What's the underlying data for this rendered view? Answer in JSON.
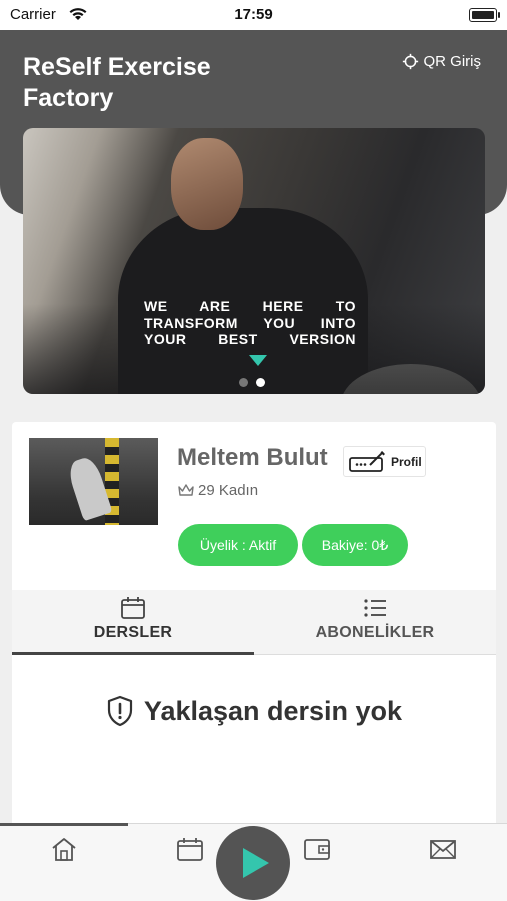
{
  "status_bar": {
    "carrier": "Carrier",
    "time": "17:59"
  },
  "header": {
    "title": "ReSelf Exercise Factory",
    "qr_label": "QR Giriş"
  },
  "banner": {
    "text": "WE ARE HERE TO TRANSFORM YOU INTO YOUR BEST VERSION",
    "slides": 2,
    "active_slide": 2
  },
  "profile": {
    "name": "Meltem Bulut",
    "edit_label": "Profil",
    "meta": "29 Kadın",
    "membership": "Üyelik : Aktif",
    "balance": "Bakiye: 0₺"
  },
  "tabs": [
    {
      "label": "DERSLER",
      "icon": "calendar-icon",
      "active": true
    },
    {
      "label": "ABONELİKLER",
      "icon": "list-icon",
      "active": false
    }
  ],
  "empty_state": {
    "icon": "shield-alert-icon",
    "text": "Yaklaşan dersin yok"
  },
  "bottom_nav": {
    "items": [
      "home-icon",
      "calendar-icon",
      "play-icon",
      "wallet-icon",
      "mail-icon"
    ],
    "active_index": 0
  },
  "colors": {
    "header": "#555555",
    "accent_green": "#3fcf5b",
    "teal": "#34c6ad"
  }
}
